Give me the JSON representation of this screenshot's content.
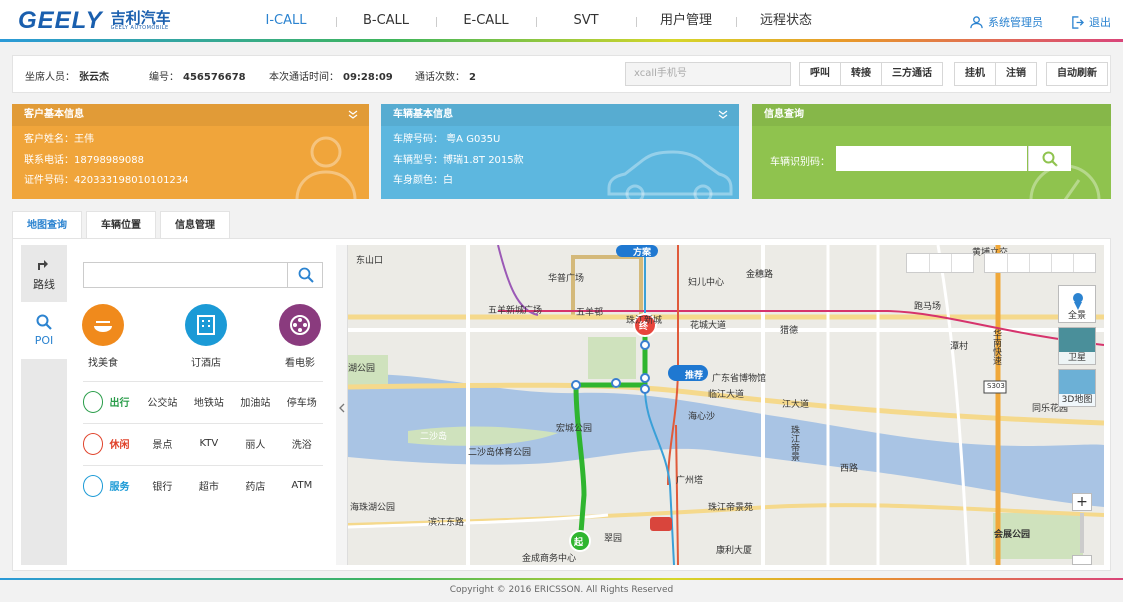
{
  "brand": {
    "logo_text": "GEELY",
    "logo_cn": "吉利汽车",
    "logo_sub": "GEELY AUTOMOBILE"
  },
  "nav": {
    "items": [
      "I-CALL",
      "B-CALL",
      "E-CALL",
      "SVT",
      "用户管理",
      "远程状态"
    ],
    "active": "I-CALL"
  },
  "header": {
    "user": "系统管理员",
    "logout": "退出"
  },
  "agent_bar": {
    "agent_label": "坐席人员：",
    "agent": "张云杰",
    "id_label": "编号：",
    "id": "456576678",
    "call_time_label": "本次通话时间：",
    "call_time": "09:28:09",
    "call_count_label": "通话次数：",
    "call_count": "2",
    "xcall_placeholder": "xcall手机号",
    "buttons_a": [
      "呼叫",
      "转接",
      "三方通话"
    ],
    "buttons_b": [
      "挂机",
      "注销"
    ],
    "auto_refresh": "自动刷新"
  },
  "customer": {
    "title": "客户基本信息",
    "lines": [
      "客户姓名：王伟",
      "联系电话：18798989088",
      "证件号码：420333198010101234"
    ]
  },
  "vehicle": {
    "title": "车辆基本信息",
    "lines": [
      "车牌号码： 粤A G035U",
      "车辆型号：博瑞1.8T 2015款",
      "车身颜色：白"
    ]
  },
  "info_query": {
    "title": "信息查询",
    "label": "车辆识别码："
  },
  "tabs": [
    "地图查询",
    "车辆位置",
    "信息管理"
  ],
  "side": {
    "route": "路线",
    "poi": "POI"
  },
  "poi": {
    "quick": [
      {
        "label": "找美食",
        "color": "#f08a1c"
      },
      {
        "label": "订酒店",
        "color": "#1b9ad6"
      },
      {
        "label": "看电影",
        "color": "#8a3b7e"
      }
    ],
    "rows": [
      {
        "head": "出行",
        "color": "#2a9d4a",
        "items": [
          "公交站",
          "地铁站",
          "加油站",
          "停车场"
        ]
      },
      {
        "head": "休闲",
        "color": "#e0432b",
        "items": [
          "景点",
          "KTV",
          "丽人",
          "洗浴"
        ]
      },
      {
        "head": "服务",
        "color": "#1b9ad6",
        "items": [
          "银行",
          "超市",
          "药店",
          "ATM"
        ]
      }
    ]
  },
  "map": {
    "labels": [
      "东山口",
      "华普广场",
      "妇儿中心",
      "金穗路",
      "五羊新城广场",
      "五羊邨",
      "珠江新城",
      "花城大道",
      "猎德",
      "跑马场",
      "潭村",
      "广东省博物馆",
      "推荐",
      "方案",
      "终",
      "起",
      "临江大道",
      "海心沙",
      "二沙岛",
      "宏城公园",
      "二沙岛体育公园",
      "广州塔",
      "珠江帝景苑",
      "海珠湖公园",
      "滨江东路",
      "翠园",
      "康利大厦",
      "金成商务中心",
      "华南快速",
      "会展公园",
      "同乐花园",
      "黄埔立交",
      "湖公园",
      "江大道",
      "西路",
      "S303",
      "珠江帝景"
    ],
    "tools": {
      "full": "全景",
      "satellite": "卫星",
      "map3d": "3D地图"
    }
  },
  "footer": "Copyright © 2016 ERICSSON. All Rights Reserved"
}
